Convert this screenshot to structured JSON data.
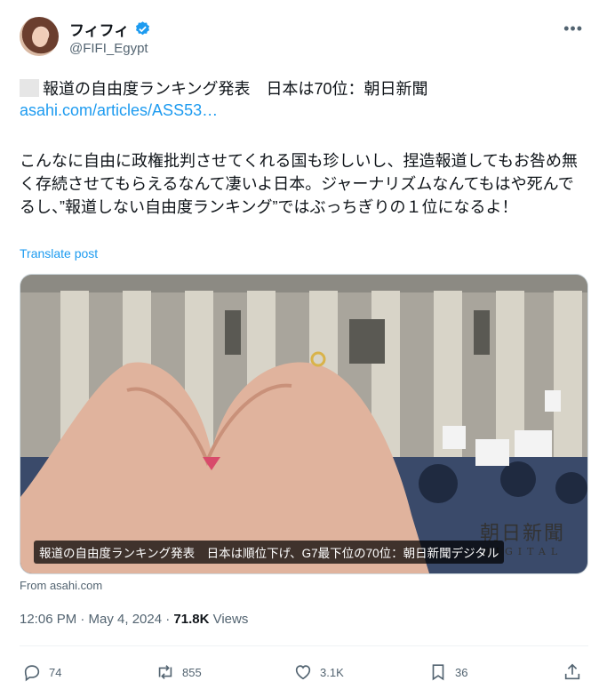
{
  "user": {
    "display_name": "フィフィ",
    "handle": "@FIFI_Egypt",
    "verified": true
  },
  "post": {
    "headline": "報道の自由度ランキング発表　日本は70位：朝日新聞",
    "link": "asahi.com/articles/ASS53…",
    "body": "こんなに自由に政権批判させてくれる国も珍しいし、捏造報道してもお咎め無く存続させてもらえるなんて凄いよ日本。ジャーナリズムなんてもはや死んでるし、”報道しない自由度ランキング”ではぶっちぎりの１位になるよ！",
    "translate": "Translate post"
  },
  "card": {
    "caption": "報道の自由度ランキング発表　日本は順位下げ、G7最下位の70位：朝日新聞デジタル",
    "brand": "朝日新聞",
    "brand_sub": "DIGITAL",
    "from": "From asahi.com"
  },
  "meta": {
    "time": "12:06 PM · May 4, 2024 · ",
    "views_count": "71.8K",
    "views_label": " Views"
  },
  "actions": {
    "replies": "74",
    "reposts": "855",
    "likes": "3.1K",
    "bookmarks": "36"
  },
  "colors": {
    "accent": "#1d9bf0",
    "muted": "#536471",
    "text": "#0f1419"
  },
  "icons": [
    "verified-badge-icon",
    "more-icon",
    "reply-icon",
    "repost-icon",
    "like-icon",
    "bookmark-icon",
    "share-icon"
  ]
}
